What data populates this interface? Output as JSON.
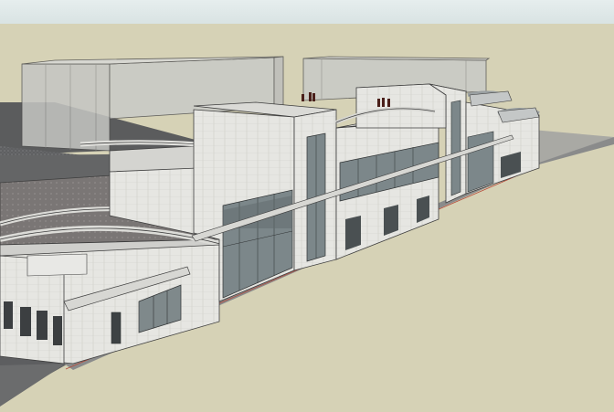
{
  "viewport": {
    "sky_color": "#dfe8e8",
    "ground_color": "#d6d2b6",
    "street_color": "#595a5a",
    "building_wall_color": "#e5e5e2",
    "glass_color": "#7f8a8c",
    "ghost_building_color": "#c9cac7"
  }
}
